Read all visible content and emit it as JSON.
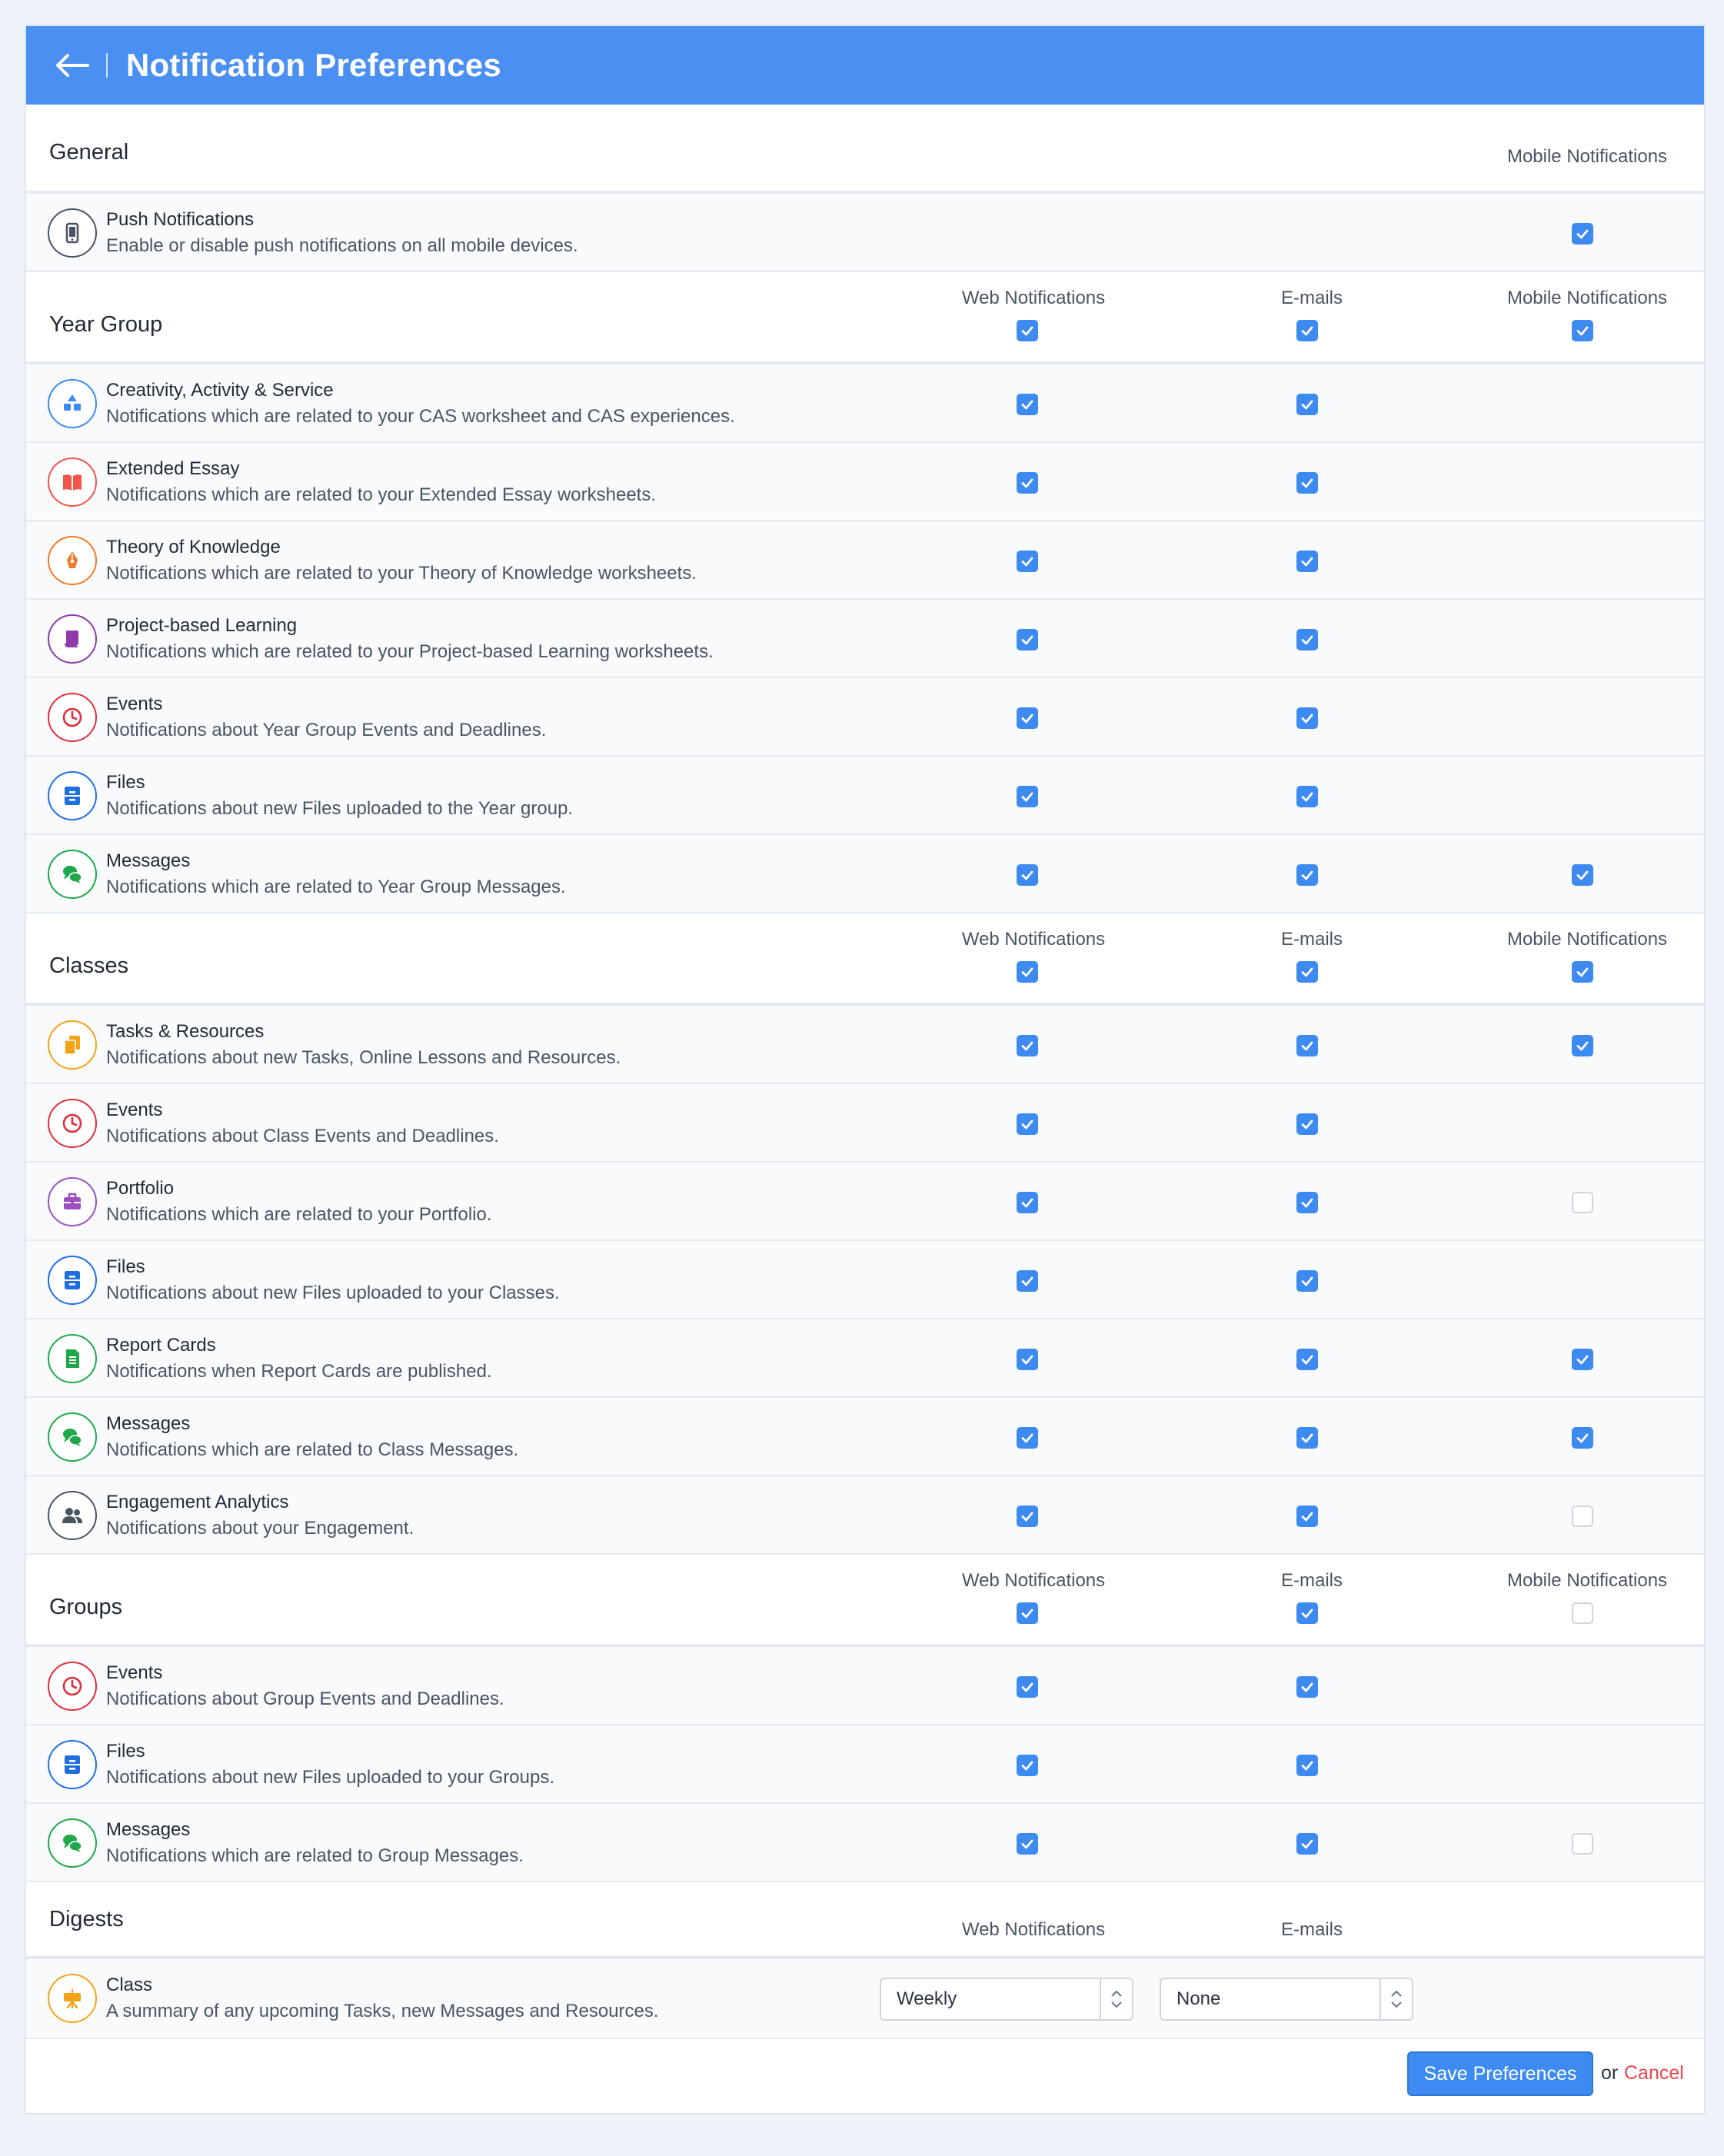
{
  "header": {
    "title": "Notification Preferences"
  },
  "columns": {
    "web": "Web Notifications",
    "email": "E-mails",
    "mobile": "Mobile Notifications"
  },
  "general": {
    "title": "General",
    "mobile_header": "Mobile Notifications",
    "rows": [
      {
        "title": "Push Notifications",
        "desc": "Enable or disable push notifications on all mobile devices.",
        "icon": "mobile-device-icon",
        "color": "#4a5563",
        "mobile": true
      }
    ]
  },
  "sections": [
    {
      "id": "year-group",
      "title": "Year Group",
      "header_checks": {
        "web": true,
        "email": true,
        "mobile": true
      },
      "rows": [
        {
          "title": "Creativity, Activity & Service",
          "desc": "Notifications which are related to your CAS worksheet and CAS experiences.",
          "icon": "shapes-icon",
          "color": "#3d8af0",
          "web": true,
          "email": true,
          "mobile": null
        },
        {
          "title": "Extended Essay",
          "desc": "Notifications which are related to your Extended Essay worksheets.",
          "icon": "book-icon",
          "color": "#f0554a",
          "web": true,
          "email": true,
          "mobile": null
        },
        {
          "title": "Theory of Knowledge",
          "desc": "Notifications which are related to your Theory of Knowledge worksheets.",
          "icon": "pen-nib-icon",
          "color": "#f07a2a",
          "web": true,
          "email": true,
          "mobile": null
        },
        {
          "title": "Project-based Learning",
          "desc": "Notifications which are related to your Project-based Learning worksheets.",
          "icon": "scroll-icon",
          "color": "#8e3aa8",
          "web": true,
          "email": true,
          "mobile": null
        },
        {
          "title": "Events",
          "desc": "Notifications about Year Group Events and Deadlines.",
          "icon": "clock-icon",
          "color": "#e02d3c",
          "web": true,
          "email": true,
          "mobile": null
        },
        {
          "title": "Files",
          "desc": "Notifications about new Files uploaded to the Year group.",
          "icon": "file-cabinet-icon",
          "color": "#1f6fe0",
          "web": true,
          "email": true,
          "mobile": null
        },
        {
          "title": "Messages",
          "desc": "Notifications which are related to Year Group Messages.",
          "icon": "chat-bubbles-icon",
          "color": "#1ea84a",
          "web": true,
          "email": true,
          "mobile": true
        }
      ]
    },
    {
      "id": "classes",
      "title": "Classes",
      "header_checks": {
        "web": true,
        "email": true,
        "mobile": true
      },
      "rows": [
        {
          "title": "Tasks & Resources",
          "desc": "Notifications about new Tasks, Online Lessons and Resources.",
          "icon": "copy-docs-icon",
          "color": "#f2a316",
          "web": true,
          "email": true,
          "mobile": true
        },
        {
          "title": "Events",
          "desc": "Notifications about Class Events and Deadlines.",
          "icon": "clock-icon",
          "color": "#e02d3c",
          "web": true,
          "email": true,
          "mobile": null
        },
        {
          "title": "Portfolio",
          "desc": "Notifications which are related to your Portfolio.",
          "icon": "briefcase-icon",
          "color": "#9b4fc0",
          "web": true,
          "email": true,
          "mobile": false
        },
        {
          "title": "Files",
          "desc": "Notifications about new Files uploaded to your Classes.",
          "icon": "file-cabinet-icon",
          "color": "#1f6fe0",
          "web": true,
          "email": true,
          "mobile": null
        },
        {
          "title": "Report Cards",
          "desc": "Notifications when Report Cards are published.",
          "icon": "report-document-icon",
          "color": "#1ea84a",
          "web": true,
          "email": true,
          "mobile": true
        },
        {
          "title": "Messages",
          "desc": "Notifications which are related to Class Messages.",
          "icon": "chat-bubbles-icon",
          "color": "#1ea84a",
          "web": true,
          "email": true,
          "mobile": true
        },
        {
          "title": "Engagement Analytics",
          "desc": "Notifications about your Engagement.",
          "icon": "users-icon",
          "color": "#4a5563",
          "web": true,
          "email": true,
          "mobile": false
        }
      ]
    },
    {
      "id": "groups",
      "title": "Groups",
      "header_checks": {
        "web": true,
        "email": true,
        "mobile": false
      },
      "rows": [
        {
          "title": "Events",
          "desc": "Notifications about Group Events and Deadlines.",
          "icon": "clock-icon",
          "color": "#e02d3c",
          "web": true,
          "email": true,
          "mobile": null
        },
        {
          "title": "Files",
          "desc": "Notifications about new Files uploaded to your Groups.",
          "icon": "file-cabinet-icon",
          "color": "#1f6fe0",
          "web": true,
          "email": true,
          "mobile": null
        },
        {
          "title": "Messages",
          "desc": "Notifications which are related to Group Messages.",
          "icon": "chat-bubbles-icon",
          "color": "#1ea84a",
          "web": true,
          "email": true,
          "mobile": false
        }
      ]
    }
  ],
  "digests": {
    "title": "Digests",
    "web_header": "Web Notifications",
    "email_header": "E-mails",
    "row": {
      "title": "Class",
      "desc": "A summary of any upcoming Tasks, new Messages and Resources.",
      "icon": "presentation-board-icon",
      "color": "#f2a316",
      "web_value": "Weekly",
      "email_value": "None"
    }
  },
  "footer": {
    "save_label": "Save Preferences",
    "or_text": "or",
    "cancel_label": "Cancel"
  },
  "colors": {
    "accent": "#4a8ff2",
    "checkbox": "#3d8af0",
    "cancel": "#e5484d"
  }
}
